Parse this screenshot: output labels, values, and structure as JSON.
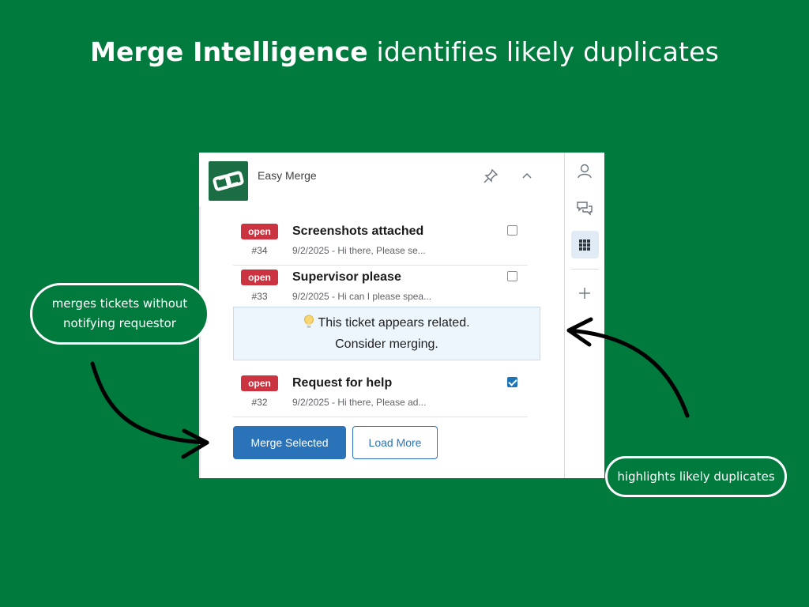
{
  "headline": {
    "bold": "Merge Intelligence",
    "rest": " identifies likely duplicates"
  },
  "app": {
    "title": "Easy Merge",
    "logo_icon": "chain-link-icon",
    "header_icons": [
      "pin-icon",
      "chevron-up-icon"
    ]
  },
  "tickets": [
    {
      "status": "open",
      "id": "#34",
      "title": "Screenshots attached",
      "snippet": "9/2/2025 - Hi there, Please se...",
      "checked": false
    },
    {
      "status": "open",
      "id": "#33",
      "title": "Supervisor please",
      "snippet": "9/2/2025 - Hi can I please spea...",
      "checked": false
    },
    {
      "status": "open",
      "id": "#32",
      "title": "Request for help",
      "snippet": "9/2/2025 - Hi there, Please ad...",
      "checked": true
    }
  ],
  "related_notice": {
    "line1": "This ticket appears related.",
    "line2": "Consider merging.",
    "icon": "lightbulb-icon"
  },
  "buttons": {
    "merge": "Merge Selected",
    "load_more": "Load More"
  },
  "sidebar": {
    "icons": [
      "user-icon",
      "conversation-icon",
      "apps-grid-icon",
      "plus-icon"
    ],
    "active": "apps-grid-icon"
  },
  "callouts": {
    "left": "merges tickets without notifying requestor",
    "right": "highlights likely duplicates"
  },
  "colors": {
    "background": "#007a3d",
    "badge": "#cc3340",
    "primary": "#2a73b9",
    "notice_bg": "#edf6fd"
  }
}
